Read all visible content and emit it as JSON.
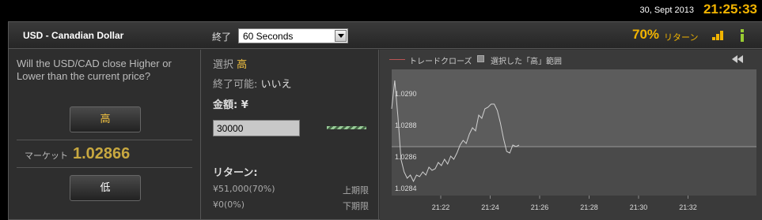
{
  "header_bar": {
    "date": "30, Sept 2013",
    "time": "21:25:33"
  },
  "instrument": {
    "name": "USD - Canadian Dollar",
    "expiry_label": "終了",
    "expiry_value": "60 Seconds",
    "return_percent": "70%",
    "return_label": "リターン",
    "bars_icon": "signal-bars-icon",
    "info_icon": "info-icon"
  },
  "trade": {
    "question": "Will the USD/CAD close Higher or Lower than the current price?",
    "high_button": "高",
    "low_button": "低",
    "market_label": "マーケット",
    "market_value": "1.02866"
  },
  "order": {
    "selection_label": "選択",
    "selection_value": "高",
    "closable_label": "終了可能:",
    "closable_value": "いいえ",
    "amount_label": "金額: ¥",
    "amount_value": "30000",
    "return_title": "リターン:",
    "payout_high": "¥51,000(70%)",
    "payout_high_label": "上期限",
    "payout_low": "¥0(0%)",
    "payout_low_label": "下期限"
  },
  "chart_data": {
    "type": "line",
    "legend": [
      "トレードクローズ",
      "選択した「高」範囲"
    ],
    "legend_placement": "top-left",
    "ylim": [
      1.02835,
      1.02915
    ],
    "y_ticks": [
      "1.0290",
      "1.0288",
      "1.0286",
      "1.0284"
    ],
    "x_ticks": [
      "21:22",
      "21:24",
      "21:26",
      "21:28",
      "21:30",
      "21:32"
    ],
    "high_range_from": 1.02866,
    "series": [
      {
        "x": [
          0,
          4,
          8,
          12,
          16,
          20,
          24,
          28,
          32,
          36,
          40,
          44,
          48,
          52,
          56,
          60,
          64,
          68,
          72,
          76,
          80,
          84,
          88,
          92,
          96,
          100,
          104,
          108,
          112,
          116,
          120,
          124,
          128,
          132,
          136,
          140,
          144,
          148,
          152,
          156,
          160,
          164
        ],
        "y": [
          1.0289,
          1.02908,
          1.02885,
          1.02858,
          1.0285,
          1.02846,
          1.02848,
          1.02844,
          1.02848,
          1.02847,
          1.0285,
          1.02848,
          1.02853,
          1.02851,
          1.02852,
          1.02856,
          1.02854,
          1.02858,
          1.02855,
          1.0286,
          1.02858,
          1.02862,
          1.02867,
          1.0287,
          1.02868,
          1.02874,
          1.02878,
          1.02876,
          1.02886,
          1.02884,
          1.0289,
          1.02891,
          1.02893,
          1.02893,
          1.02889,
          1.02881,
          1.02871,
          1.02863,
          1.02862,
          1.02867,
          1.02866,
          1.02867
        ]
      }
    ]
  }
}
